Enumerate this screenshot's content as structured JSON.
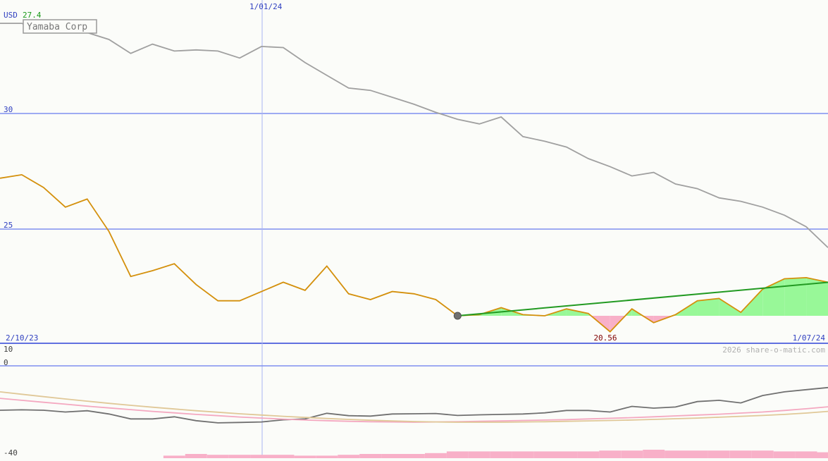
{
  "header": {
    "currency": "USD",
    "last_price": "27.4",
    "company": "Yamaba Corp"
  },
  "footer": {
    "credit": "2026 share-o-matic.com"
  },
  "colors": {
    "background": "#fbfcf9",
    "gridline": "#7f8ff0",
    "axis_text": "#3040c0",
    "price_line": "#d4900c",
    "compare_line": "#a0a0a0",
    "trend_line": "#229a22",
    "gain_fill": "#98f898",
    "loss_fill": "#f8b0c8",
    "osc_line": "#707070",
    "osc_pink": "#f4a8c0",
    "osc_tan": "#e0c898",
    "volume_bar": "#f8b0c8",
    "low_label": "#800000",
    "last_price": "#1a9a1a",
    "credit": "#b0b0b0"
  },
  "chart_data": [
    {
      "type": "line",
      "title": "Yamaba Corp",
      "ylabel": "USD",
      "y_ticks": [
        "30",
        "25"
      ],
      "ylim": [
        20.2,
        34.0
      ],
      "x_labels": {
        "start": "2/10/23",
        "marker": "1/01/24",
        "end": "1/07/24"
      },
      "marker_index": 12,
      "series": [
        {
          "values": [
            27.2,
            27.35,
            26.8,
            25.95,
            26.3,
            24.9,
            22.95,
            23.2,
            23.5,
            22.6,
            21.9,
            21.9,
            22.3,
            22.7,
            22.35,
            23.4,
            22.2,
            21.95,
            22.3,
            22.2,
            21.95,
            21.25,
            21.3,
            21.6,
            21.3,
            21.25,
            21.55,
            21.35,
            20.56,
            21.55,
            20.95,
            21.3,
            21.9,
            22.0,
            21.4,
            22.4,
            22.85,
            22.9,
            22.7
          ],
          "low_label": "20.56",
          "last_label": "27.4"
        },
        {
          "values": [
            33.9,
            33.9,
            33.6,
            33.5,
            33.5,
            33.2,
            32.6,
            33.0,
            32.7,
            32.75,
            32.7,
            32.4,
            32.9,
            32.85,
            32.2,
            31.65,
            31.1,
            31.0,
            30.7,
            30.4,
            30.05,
            29.75,
            29.55,
            29.85,
            29.0,
            28.8,
            28.55,
            28.05,
            27.7,
            27.3,
            27.45,
            26.95,
            26.75,
            26.35,
            26.2,
            25.95,
            25.6,
            25.1,
            24.2
          ]
        }
      ],
      "trend": {
        "from_index": 21,
        "to_index": 38,
        "start_value": 21.25,
        "end_value": 22.7
      },
      "baseline_value": 21.25
    },
    {
      "type": "line",
      "y_ticks": [
        "10",
        "0",
        "-40"
      ],
      "ylim": [
        -40,
        10
      ],
      "series": [
        {
          "color_key": "osc_line",
          "values": [
            -20.5,
            -20.3,
            -20.5,
            -21.3,
            -20.7,
            -22.2,
            -24.5,
            -24.5,
            -23.5,
            -25.3,
            -26.3,
            -26.1,
            -25.9,
            -24.9,
            -24.5,
            -21.9,
            -23.0,
            -23.2,
            -22.2,
            -22.1,
            -22.0,
            -22.9,
            -22.6,
            -22.4,
            -22.2,
            -21.7,
            -20.6,
            -20.6,
            -21.3,
            -18.7,
            -19.5,
            -19.0,
            -16.5,
            -15.9,
            -17.1,
            -13.7,
            -12.0,
            -11.0,
            -10.0
          ]
        },
        {
          "color_key": "osc_pink",
          "values": [
            -15.0,
            -15.9,
            -16.8,
            -17.7,
            -18.6,
            -19.4,
            -20.2,
            -21.0,
            -21.7,
            -22.4,
            -23.0,
            -23.6,
            -24.1,
            -24.6,
            -25.0,
            -25.3,
            -25.6,
            -25.8,
            -25.9,
            -26.0,
            -25.9,
            -25.8,
            -25.6,
            -25.4,
            -25.2,
            -25.0,
            -24.8,
            -24.5,
            -24.2,
            -23.9,
            -23.5,
            -23.1,
            -22.7,
            -22.3,
            -21.8,
            -21.3,
            -20.6,
            -19.8,
            -18.9
          ]
        },
        {
          "color_key": "osc_tan",
          "values": [
            -12.0,
            -13.1,
            -14.2,
            -15.3,
            -16.3,
            -17.3,
            -18.2,
            -19.1,
            -19.9,
            -20.7,
            -21.4,
            -22.1,
            -22.7,
            -23.3,
            -23.8,
            -24.3,
            -24.7,
            -25.1,
            -25.4,
            -25.7,
            -25.9,
            -26.0,
            -26.0,
            -26.0,
            -25.9,
            -25.8,
            -25.6,
            -25.4,
            -25.2,
            -25.0,
            -24.7,
            -24.4,
            -24.1,
            -23.7,
            -23.3,
            -22.9,
            -22.4,
            -21.8,
            -21.0
          ]
        }
      ],
      "volume": [
        4,
        4,
        4,
        4,
        4,
        4,
        4,
        4,
        3,
        5,
        4,
        4,
        4,
        4,
        3,
        3,
        4,
        5,
        5,
        5,
        6,
        8,
        8,
        8,
        8,
        8,
        8,
        8,
        9,
        9,
        10,
        9,
        9,
        9,
        9,
        9,
        8,
        8,
        7
      ]
    }
  ]
}
